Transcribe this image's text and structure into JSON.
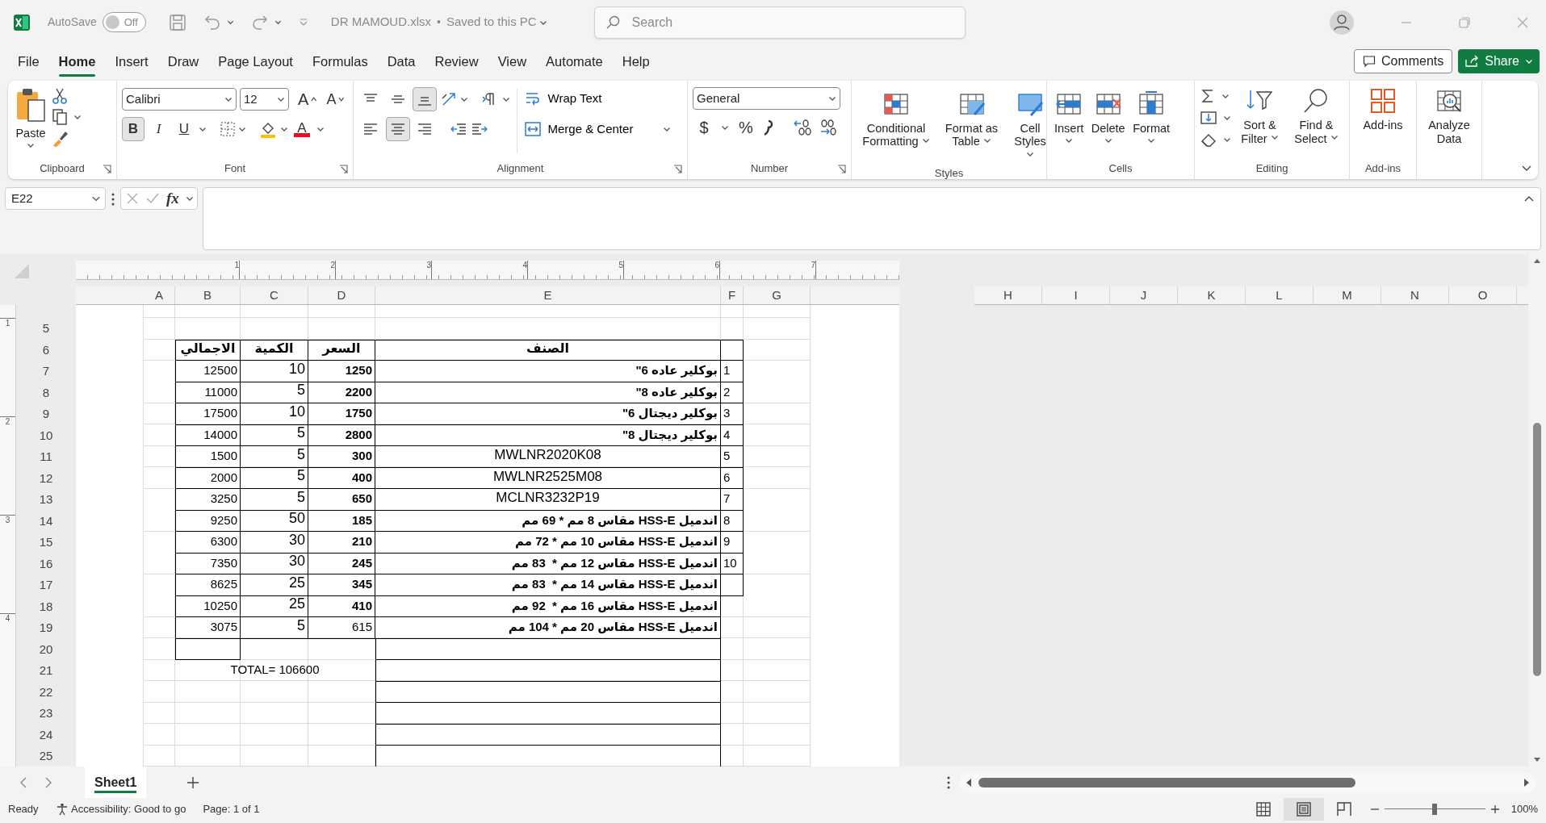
{
  "title_bar": {
    "autosave_label": "AutoSave",
    "autosave_on": false,
    "autosave_state": "Off",
    "file_name": "DR MAMOUD.xlsx",
    "separator": "•",
    "save_status": "Saved to this PC",
    "search_placeholder": "Search"
  },
  "menu_tabs": [
    {
      "label": "File",
      "selected": false
    },
    {
      "label": "Home",
      "selected": true
    },
    {
      "label": "Insert",
      "selected": false
    },
    {
      "label": "Draw",
      "selected": false
    },
    {
      "label": "Page Layout",
      "selected": false
    },
    {
      "label": "Formulas",
      "selected": false
    },
    {
      "label": "Data",
      "selected": false
    },
    {
      "label": "Review",
      "selected": false
    },
    {
      "label": "View",
      "selected": false
    },
    {
      "label": "Automate",
      "selected": false
    },
    {
      "label": "Help",
      "selected": false
    }
  ],
  "comments_button": "Comments",
  "share_button": "Share",
  "ribbon_groups": [
    {
      "kind": "clipboard",
      "label": "Clipboard",
      "paste": "Paste"
    },
    {
      "kind": "font",
      "label": "Font",
      "font_name": "Calibri",
      "font_size": "12",
      "grow_glyph": "A",
      "shrink_glyph": "A",
      "toggles": [
        {
          "glyph": "B",
          "selected": true
        },
        {
          "glyph": "I",
          "selected": false
        },
        {
          "glyph": "U",
          "selected": false
        }
      ],
      "font_color_glyph": "A"
    },
    {
      "kind": "alignment",
      "label": "Alignment",
      "vertical_align": [
        {
          "selected": false
        },
        {
          "selected": false
        },
        {
          "selected": true
        }
      ],
      "horizontal_align": [
        {
          "selected": false
        },
        {
          "selected": true
        },
        {
          "selected": false
        }
      ],
      "wrap_text": "Wrap Text",
      "merge": "Merge & Center"
    },
    {
      "kind": "number",
      "label": "Number",
      "format": "General",
      "currency": "$",
      "percent": "%"
    },
    {
      "kind": "styles",
      "label": "Styles",
      "buttons": [
        "Conditional Formatting",
        "Format as Table",
        "Cell Styles"
      ]
    },
    {
      "kind": "cells",
      "label": "Cells",
      "buttons": [
        "Insert",
        "Delete",
        "Format"
      ]
    },
    {
      "kind": "editing",
      "label": "Editing",
      "buttons": [
        "Sort & Filter",
        "Find & Select"
      ]
    },
    {
      "kind": "addins",
      "label": "Add-ins",
      "buttons": [
        "Add-ins"
      ]
    },
    {
      "kind": "analyze",
      "buttons": [
        "Analyze Data"
      ]
    }
  ],
  "formula_bar": {
    "name_box": "E22",
    "fx": "fx"
  },
  "ruler_marks": [
    "1",
    "2",
    "3",
    "4",
    "5",
    "6",
    "7"
  ],
  "vertical_ruler_marks": [
    "1",
    "2",
    "3",
    "4"
  ],
  "columns": {
    "page_1": [
      "A",
      "B",
      "C",
      "D",
      "E",
      "F",
      "G"
    ],
    "page_2": [
      "H",
      "I",
      "J",
      "K",
      "L",
      "M",
      "N",
      "O"
    ]
  },
  "rows": [
    {
      "number": "5",
      "kind": "blank"
    },
    {
      "number": "6",
      "kind": "header",
      "total": "الاجمالي",
      "quantity": "الكمية",
      "price": "السعر",
      "item": "الصنف"
    },
    {
      "number": "7",
      "kind": "item",
      "total": "12500",
      "quantity": "10",
      "price": "1250",
      "price_bold": true,
      "item": "بوكلير عاده 6\"",
      "index": "1"
    },
    {
      "number": "8",
      "kind": "item",
      "total": "11000",
      "quantity": "5",
      "price": "2200",
      "price_bold": true,
      "item": "بوكلير عاده 8\"",
      "index": "2"
    },
    {
      "number": "9",
      "kind": "item",
      "total": "17500",
      "quantity": "10",
      "price": "1750",
      "price_bold": true,
      "item": "بوكلير ديجتال 6\"",
      "index": "3"
    },
    {
      "number": "10",
      "kind": "item",
      "total": "14000",
      "quantity": "5",
      "price": "2800",
      "price_bold": true,
      "item": "بوكلير ديجتال 8\"",
      "index": "4"
    },
    {
      "number": "11",
      "kind": "code_item",
      "total": "1500",
      "quantity": "5",
      "price": "300",
      "price_bold": true,
      "item": "MWLNR2020K08",
      "index": "5"
    },
    {
      "number": "12",
      "kind": "code_item",
      "total": "2000",
      "quantity": "5",
      "price": "400",
      "price_bold": true,
      "item": "MWLNR2525M08",
      "index": "6"
    },
    {
      "number": "13",
      "kind": "code_item",
      "total": "3250",
      "quantity": "5",
      "price": "650",
      "price_bold": true,
      "item": "MCLNR3232P19",
      "index": "7"
    },
    {
      "number": "14",
      "kind": "item",
      "total": "9250",
      "quantity": "50",
      "price": "185",
      "price_bold": true,
      "item": "اندميل HSS-E مقاس 8 مم * 69 مم",
      "index": "8"
    },
    {
      "number": "15",
      "kind": "item",
      "total": "6300",
      "quantity": "30",
      "price": "210",
      "price_bold": true,
      "item": "اندميل HSS-E مقاس 10 مم * 72 مم",
      "index": "9"
    },
    {
      "number": "16",
      "kind": "item",
      "total": "7350",
      "quantity": "30",
      "price": "245",
      "price_bold": true,
      "item": "اندميل HSS-E مقاس 12 مم *  83 مم",
      "index": "10"
    },
    {
      "number": "17",
      "kind": "item",
      "total": "8625",
      "quantity": "25",
      "price": "345",
      "price_bold": true,
      "item": "اندميل HSS-E مقاس 14 مم *  83 مم"
    },
    {
      "number": "18",
      "kind": "item",
      "total": "10250",
      "quantity": "25",
      "price": "410",
      "price_bold": true,
      "item": "اندميل HSS-E مقاس 16 مم *  92 مم"
    },
    {
      "number": "19",
      "kind": "item",
      "total": "3075",
      "quantity": "5",
      "price": "615",
      "price_bold": false,
      "item": "اندميل HSS-E مقاس 20 مم * 104 مم"
    },
    {
      "number": "20",
      "kind": "empty_box"
    },
    {
      "number": "21",
      "kind": "total",
      "total_text": "TOTAL= 106600"
    },
    {
      "number": "22",
      "kind": "lined"
    },
    {
      "number": "23",
      "kind": "lined"
    },
    {
      "number": "24",
      "kind": "lined"
    },
    {
      "number": "25",
      "kind": "lined"
    }
  ],
  "sheet_tabs": [
    {
      "label": "Sheet1",
      "selected": true
    }
  ],
  "status_bar": {
    "ready": "Ready",
    "accessibility": "Accessibility: Good to go",
    "page": "Page: 1 of 1",
    "views": [
      {
        "kind": "normal",
        "selected": false
      },
      {
        "kind": "page_layout",
        "selected": true
      },
      {
        "kind": "page_break",
        "selected": false
      }
    ],
    "zoom": {
      "level": 0.5,
      "reading": "100%"
    }
  }
}
